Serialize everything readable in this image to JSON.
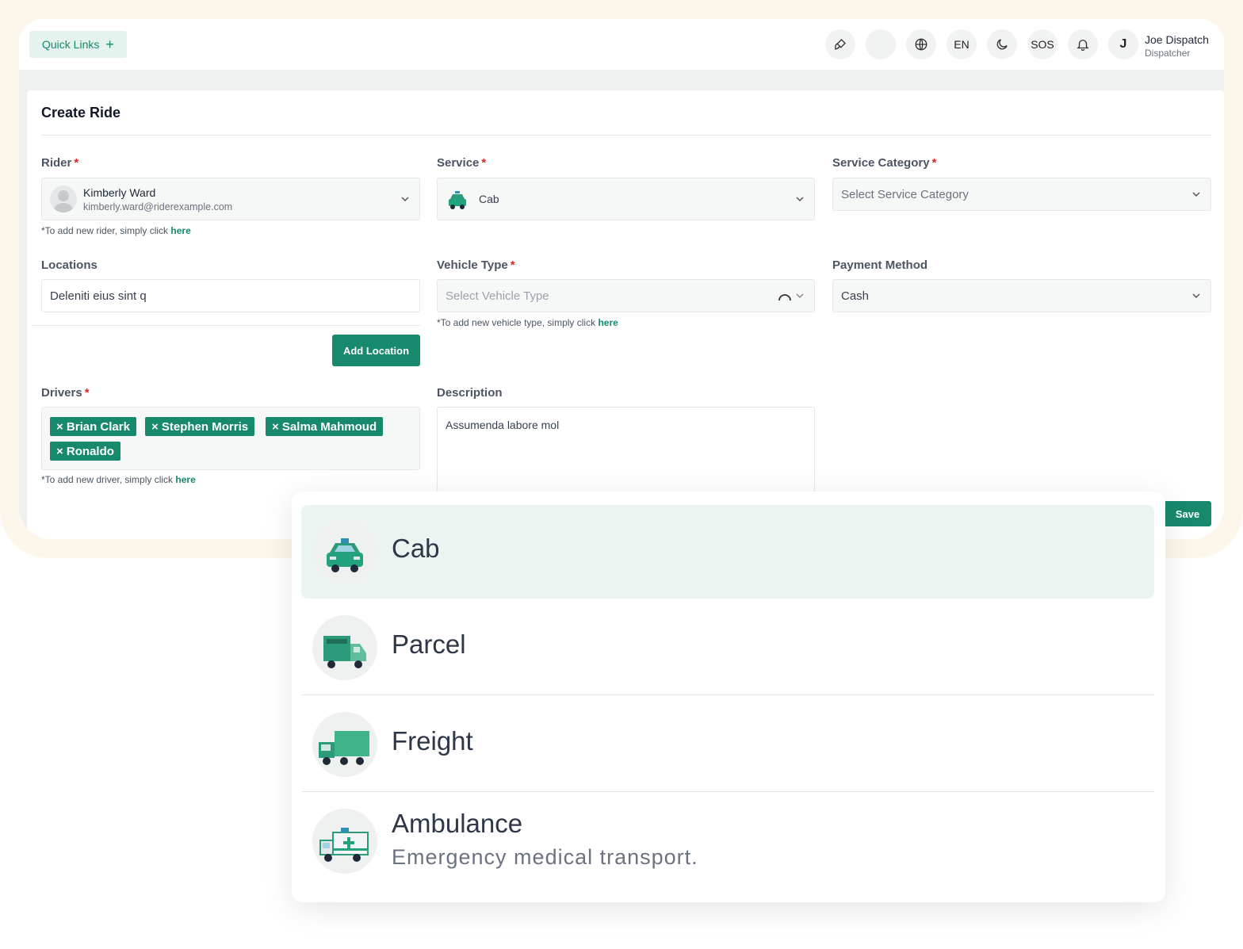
{
  "topbar": {
    "quick_links": "Quick Links",
    "language": "EN",
    "sos": "SOS",
    "user_initial": "J",
    "user_name": "Joe Dispatch",
    "user_role": "Dispatcher"
  },
  "form": {
    "title": "Create Ride",
    "rider": {
      "label": "Rider",
      "name": "Kimberly Ward",
      "email": "kimberly.ward@riderexample.com",
      "hint_prefix": "*To add new rider, simply click",
      "hint_link": "here"
    },
    "service": {
      "label": "Service",
      "value": "Cab"
    },
    "service_category": {
      "label": "Service Category",
      "placeholder": "Select Service Category"
    },
    "locations": {
      "label": "Locations",
      "value": "Deleniti eius sint q",
      "add_button": "Add Location"
    },
    "vehicle_type": {
      "label": "Vehicle Type",
      "placeholder": "Select Vehicle Type",
      "hint_prefix": "*To add new vehicle type, simply click",
      "hint_link": "here"
    },
    "payment_method": {
      "label": "Payment Method",
      "value": "Cash"
    },
    "drivers": {
      "label": "Drivers",
      "tags": [
        "× Brian Clark",
        "× Stephen Morris",
        "× Salma Mahmoud",
        "× Ronaldo"
      ],
      "hint_prefix": "*To add new driver, simply click",
      "hint_link": "here"
    },
    "description": {
      "label": "Description",
      "value": "Assumenda labore mol"
    },
    "save_button": "Save"
  },
  "service_dropdown": {
    "options": [
      {
        "label": "Cab",
        "sub": "",
        "icon": "cab-icon",
        "active": true
      },
      {
        "label": "Parcel",
        "sub": "",
        "icon": "parcel-truck-icon",
        "active": false
      },
      {
        "label": "Freight",
        "sub": "",
        "icon": "freight-truck-icon",
        "active": false
      },
      {
        "label": "Ambulance",
        "sub": "Emergency medical transport.",
        "icon": "ambulance-icon",
        "active": false
      }
    ]
  },
  "colors": {
    "primary": "#17896d",
    "primary_light": "#e4f3ee",
    "required": "#dc2626",
    "frame": "#fdf6ea"
  }
}
